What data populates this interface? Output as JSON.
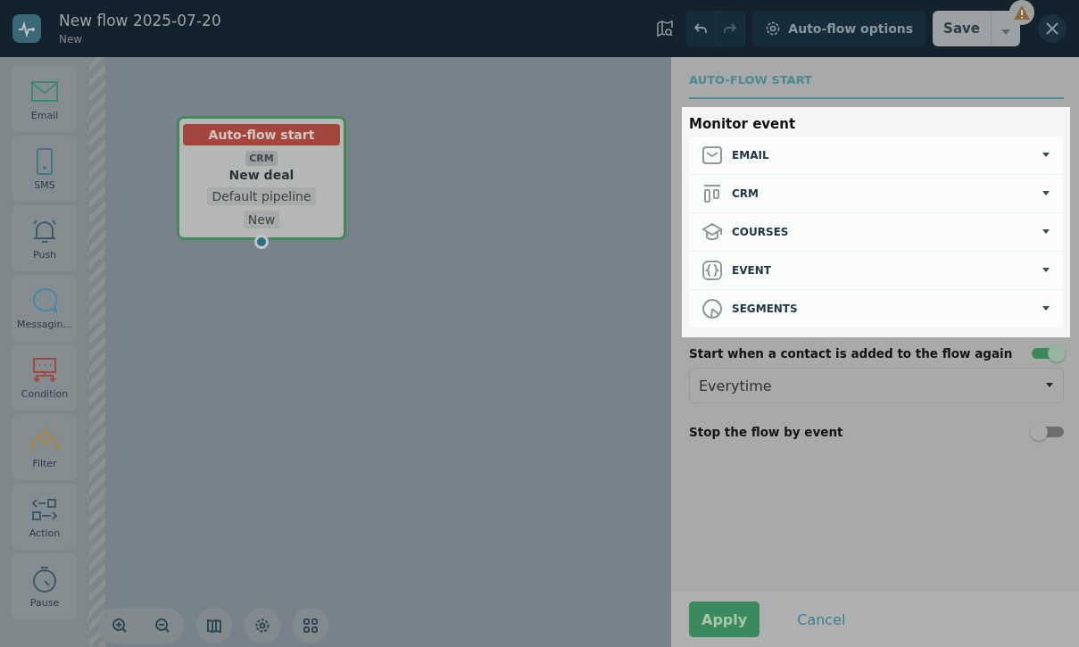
{
  "header": {
    "title": "New flow 2025-07-20",
    "subtitle": "New",
    "options_button": "Auto-flow options",
    "save_button": "Save"
  },
  "sidebar": {
    "items": [
      {
        "kind": "email",
        "label": "Email"
      },
      {
        "kind": "sms",
        "label": "SMS"
      },
      {
        "kind": "push",
        "label": "Push"
      },
      {
        "kind": "messaging",
        "label": "Messagin..."
      },
      {
        "kind": "condition",
        "label": "Condition"
      },
      {
        "kind": "filter",
        "label": "Filter"
      },
      {
        "kind": "action",
        "label": "Action"
      },
      {
        "kind": "pause",
        "label": "Pause"
      }
    ]
  },
  "node": {
    "title": "Auto-flow start",
    "tag": "CRM",
    "name": "New deal",
    "pipeline": "Default pipeline",
    "stage": "New"
  },
  "panel": {
    "tab": "AUTO-FLOW START",
    "monitor_title": "Monitor event",
    "events": [
      {
        "kind": "email",
        "label": "EMAIL"
      },
      {
        "kind": "crm",
        "label": "CRM"
      },
      {
        "kind": "courses",
        "label": "COURSES"
      },
      {
        "kind": "event",
        "label": "EVENT"
      },
      {
        "kind": "segments",
        "label": "SEGMENTS"
      }
    ],
    "restart": {
      "label": "Start when a contact is added to the flow again",
      "on": true,
      "value": "Everytime"
    },
    "stop": {
      "label": "Stop the flow by event",
      "on": false
    },
    "apply": "Apply",
    "cancel": "Cancel"
  }
}
